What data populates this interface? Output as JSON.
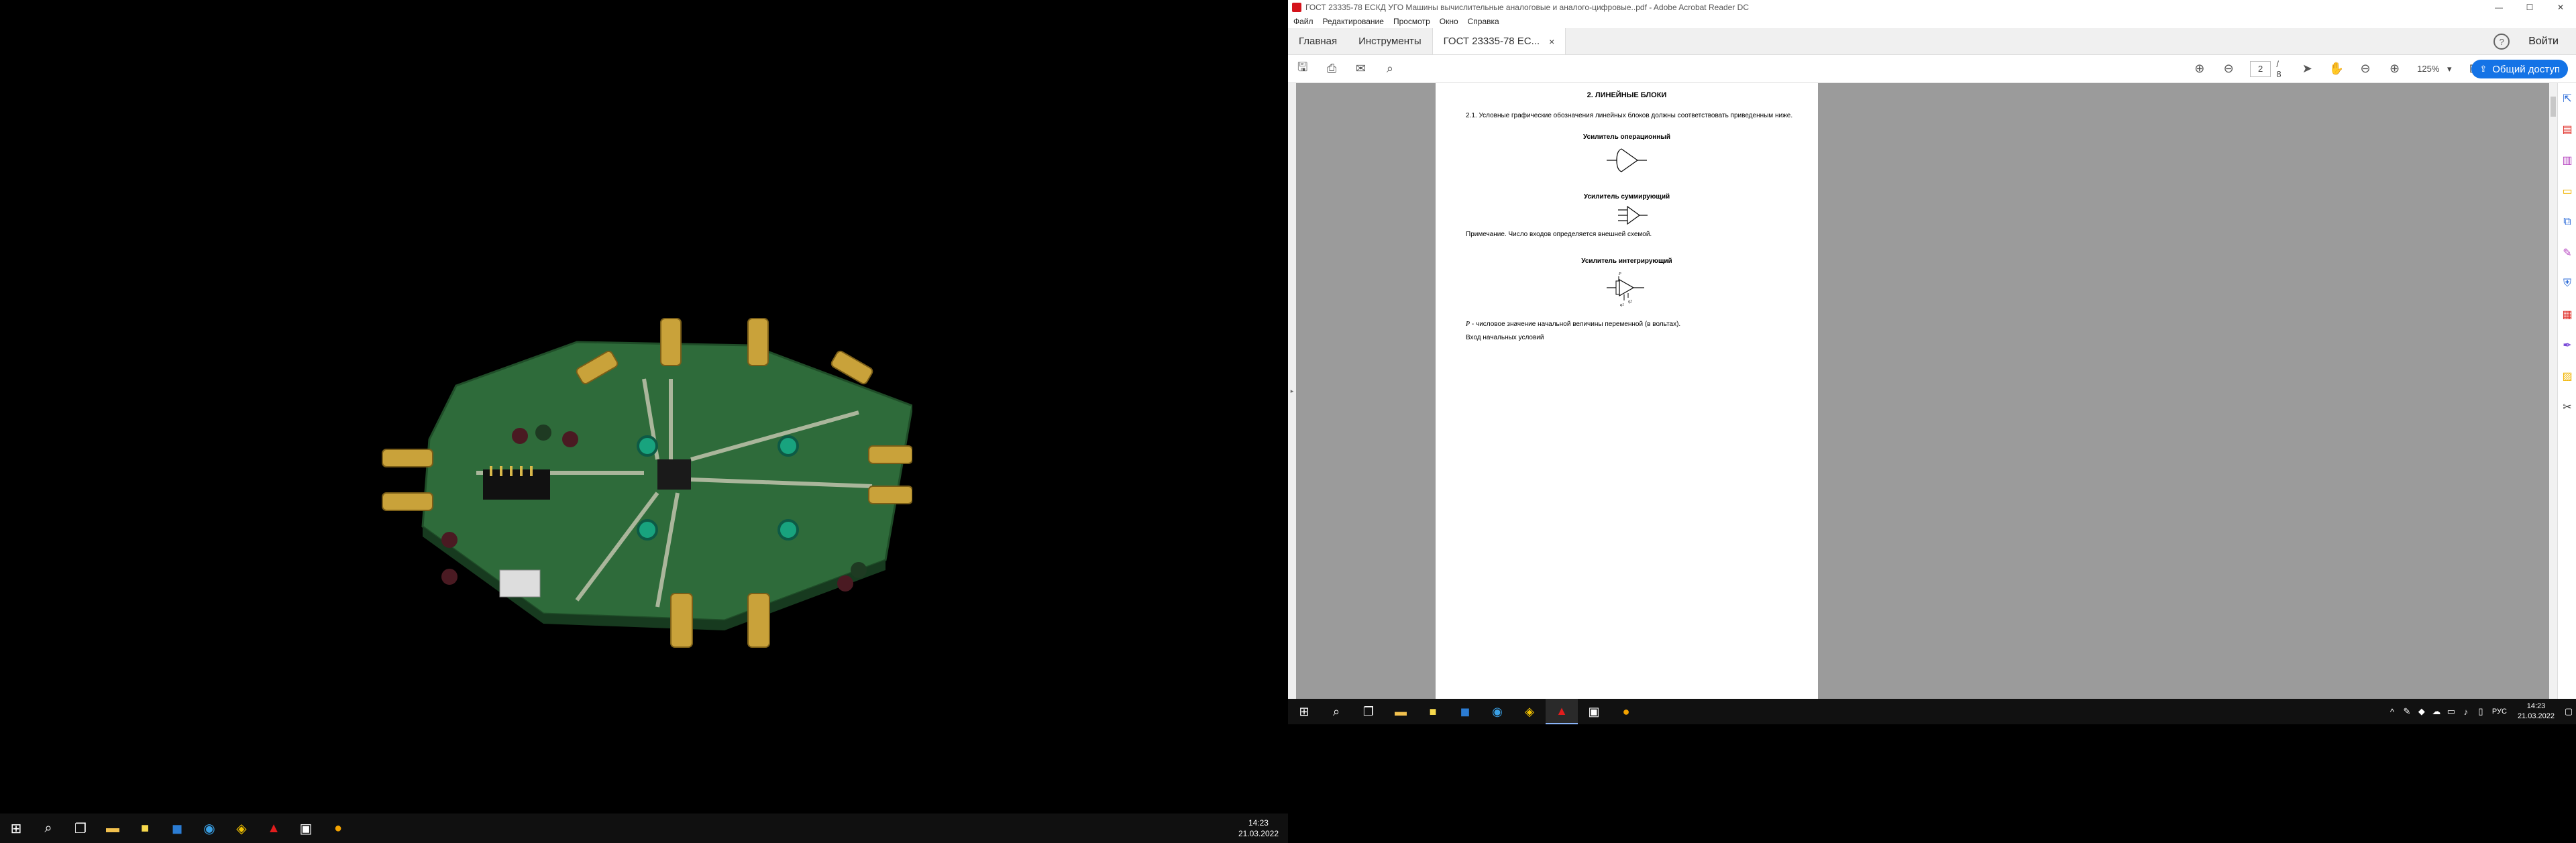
{
  "left_taskbar": {
    "clock_time": "14:23",
    "clock_date": "21.03.2022"
  },
  "window": {
    "title": "ГОСТ 23335-78 ЕСКД УГО Машины вычислительные аналоговые и аналого-цифровые..pdf - Adobe Acrobat Reader DC",
    "minimize": "—",
    "maximize": "☐",
    "close": "✕"
  },
  "menu": [
    "Файл",
    "Редактирование",
    "Просмотр",
    "Окно",
    "Справка"
  ],
  "tabs": {
    "home": "Главная",
    "tools": "Инструменты",
    "document": "ГОСТ 23335-78 ЕС...",
    "close": "×",
    "help": "?",
    "signin": "Войти"
  },
  "toolbar": {
    "page_current": "2",
    "page_total": "/ 8",
    "zoom": "125%",
    "share_label": "Общий доступ",
    "icons": [
      "save-icon",
      "print-icon",
      "mail-icon",
      "search-icon",
      "page-up-icon",
      "page-down-icon",
      "select-icon",
      "hand-icon",
      "zoom-out-icon",
      "zoom-in-icon",
      "fit-icon",
      "highlight-icon",
      "comment-icon",
      "pen-icon"
    ]
  },
  "document": {
    "section_title": "2. ЛИНЕЙНЫЕ БЛОКИ",
    "para_2_1": "2.1. Условные графические обозначения линейных блоков должны соответствовать приведенным ниже.",
    "heading_opamp": "Усилитель операционный",
    "heading_summing": "Усилитель суммирующий",
    "note": "Примечание. Число входов определяется внешней схемой.",
    "heading_integrating": "Усилитель интегрирующий",
    "symbol_label_p": "P",
    "symbol_label_q1": "q1",
    "symbol_label_q2": "q2",
    "p_description": "- числовое значение начальной величины переменной (в вольтах).",
    "p_symbol": "P",
    "cutoff_text": "Вход начальных условий"
  },
  "right_taskbar": {
    "lang": "РУС",
    "clock_time": "14:23",
    "clock_date": "21.03.2022"
  },
  "colors": {
    "accent": "#1473e6",
    "doc_background": "#9b9b9b",
    "pcb_green": "#2e6b3a",
    "gold": "#c9a23a"
  }
}
